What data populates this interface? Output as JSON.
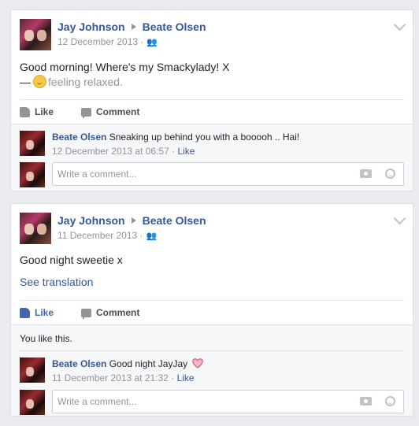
{
  "posts": [
    {
      "author": "Jay Johnson",
      "recipient": "Beate Olsen",
      "date": "12 December 2013",
      "text": "Good morning! Where's my Smackylady! X",
      "feeling_prefix": "—",
      "feeling": "feeling relaxed.",
      "like_label": "Like",
      "comment_label": "Comment",
      "comment": {
        "author": "Beate Olsen",
        "text": "Sneaking up behind you with a booooh .. Hai!",
        "time": "12 December 2013 at 06:57",
        "like_label": "Like"
      },
      "comment_placeholder": "Write a comment..."
    },
    {
      "author": "Jay Johnson",
      "recipient": "Beate Olsen",
      "date": "11 December 2013",
      "text": "Good night sweetie x",
      "translation_link": "See translation",
      "like_label": "Like",
      "comment_label": "Comment",
      "likes_summary": "You like this.",
      "comment": {
        "author": "Beate Olsen",
        "text": "Good night JayJay",
        "time": "11 December 2013 at 21:32",
        "like_label": "Like"
      },
      "comment_placeholder": "Write a comment..."
    }
  ],
  "colors": {
    "link": "#365899",
    "liked": "#4267b2",
    "muted": "#90949c"
  },
  "icons": [
    "friends-icon",
    "chevron-down-icon",
    "relaxed-emoji-icon",
    "like-thumb-icon",
    "comment-bubble-icon",
    "heart-icon",
    "camera-icon",
    "emoji-smile-icon"
  ]
}
